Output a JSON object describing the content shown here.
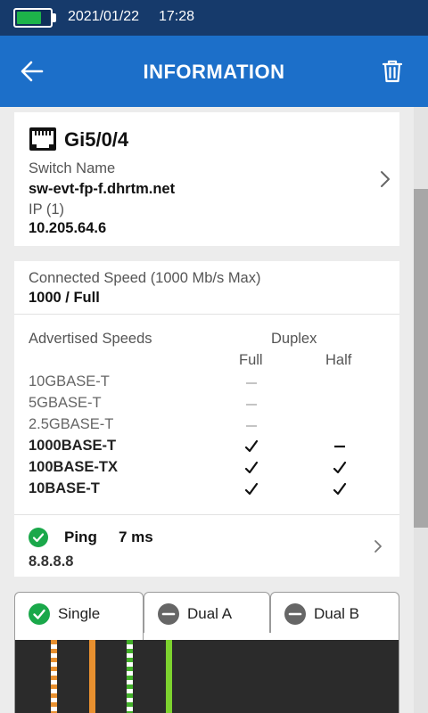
{
  "status_bar": {
    "date": "2021/01/22",
    "time": "17:28",
    "battery_level": 0.75,
    "battery_color": "#1db34a",
    "icon": "battery-icon"
  },
  "app_bar": {
    "title": "INFORMATION",
    "back_icon": "arrow-left-icon",
    "delete_icon": "trash-icon",
    "color": "#1c6fc9"
  },
  "switch_card": {
    "icon": "ethernet-port-icon",
    "port": "Gi5/0/4",
    "switch_name_label": "Switch Name",
    "switch_name": "sw-evt-fp-f.dhrtm.net",
    "ip_label": "IP (1)",
    "ip": "10.205.64.6"
  },
  "speed_card": {
    "connected_label": "Connected Speed (1000 Mb/s Max)",
    "connected_value": "1000 / Full",
    "advertised_label": "Advertised Speeds",
    "duplex_label": "Duplex",
    "full_label": "Full",
    "half_label": "Half",
    "rows": [
      {
        "name": "10GBASE-T",
        "full": "n/a",
        "half": "none",
        "bold": false
      },
      {
        "name": "5GBASE-T",
        "full": "n/a",
        "half": "none",
        "bold": false
      },
      {
        "name": "2.5GBASE-T",
        "full": "n/a",
        "half": "none",
        "bold": false
      },
      {
        "name": "1000BASE-T",
        "full": "check",
        "half": "no",
        "bold": true
      },
      {
        "name": "100BASE-TX",
        "full": "check",
        "half": "check",
        "bold": true
      },
      {
        "name": "10BASE-T",
        "full": "check",
        "half": "check",
        "bold": true
      }
    ],
    "ping": {
      "label": "Ping",
      "value": "7 ms",
      "host": "8.8.8.8",
      "status_color": "#1aa84a"
    }
  },
  "tabs": [
    {
      "label": "Single",
      "icon": "check-circle-icon",
      "active": true
    },
    {
      "label": "Dual A",
      "icon": "minus-circle-icon",
      "active": false
    },
    {
      "label": "Dual B",
      "icon": "minus-circle-icon",
      "active": false
    }
  ],
  "wire_colors": [
    "#ffffff/#e8902f",
    "#e8902f",
    "#ffffff/#43b02a",
    "#43b02a"
  ]
}
